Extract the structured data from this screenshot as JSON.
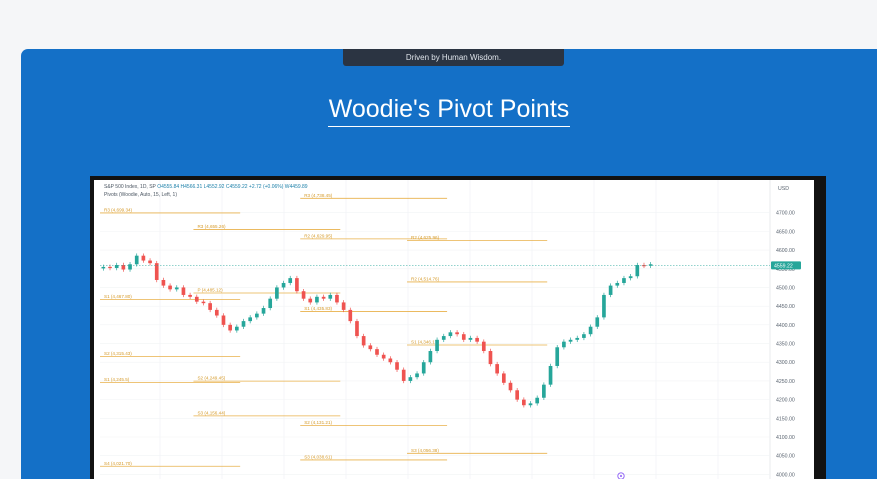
{
  "tagline": "Driven by Human Wisdom.",
  "headline": "Woodie's Pivot Points",
  "legend": {
    "symbol": "S&P 500 Index, 1D, SP",
    "values": "O4555.84  H4566.31  L4552.92  C4559.22  +2.72 (+0.06%)  W4459.89",
    "indicator": "Pivots (Woodie, Auto, 15, Left, 1)"
  },
  "colors": {
    "panel": "#1470c7",
    "up_candle": "#26a69a",
    "down_candle": "#ef5350",
    "pivot_line": "#e8b04a",
    "pivot_label": "#d59a2a",
    "last_price": "#26a69a"
  },
  "chart_data": {
    "type": "candlestick",
    "price_axis": {
      "currency": "USD",
      "ticks": [
        "4700.00",
        "4650.00",
        "4600.00",
        "4550.00",
        "4500.00",
        "4450.00",
        "4400.00",
        "4350.00",
        "4300.00",
        "4250.00",
        "4200.00",
        "4150.00",
        "4100.00",
        "4050.00",
        "4000.00"
      ],
      "ylim": [
        3985,
        4750
      ],
      "last_price_label": "4559.22"
    },
    "closes": [
      4555,
      4552,
      4560,
      4548,
      4562,
      4585,
      4572,
      4565,
      4520,
      4505,
      4495,
      4500,
      4480,
      4475,
      4462,
      4458,
      4440,
      4425,
      4400,
      4385,
      4395,
      4410,
      4420,
      4430,
      4445,
      4470,
      4500,
      4512,
      4525,
      4490,
      4470,
      4460,
      4475,
      4470,
      4480,
      4460,
      4440,
      4410,
      4370,
      4345,
      4335,
      4320,
      4310,
      4300,
      4280,
      4250,
      4260,
      4270,
      4300,
      4330,
      4360,
      4370,
      4380,
      4375,
      4360,
      4365,
      4355,
      4330,
      4295,
      4270,
      4245,
      4225,
      4200,
      4185,
      4190,
      4205,
      4240,
      4290,
      4340,
      4355,
      4360,
      4365,
      4375,
      4395,
      4420,
      4480,
      4505,
      4512,
      4525,
      4530,
      4560,
      4558,
      4562
    ],
    "pivot_levels": [
      {
        "label": "R3 (4,738.45)",
        "price": 4738.45,
        "from": 30,
        "to": 52
      },
      {
        "label": "R3 (4,699.34)",
        "price": 4699.34,
        "from": 0,
        "to": 21
      },
      {
        "label": "R3 (4,655.26)",
        "price": 4655.26,
        "from": 14,
        "to": 36
      },
      {
        "label": "R2 (4,629.95)",
        "price": 4629.95,
        "from": 30,
        "to": 52
      },
      {
        "label": "R2 (4,625.96)",
        "price": 4625.96,
        "from": 46,
        "to": 67
      },
      {
        "label": "R2 (4,514.76)",
        "price": 4514.76,
        "from": 46,
        "to": 67
      },
      {
        "label": "P (4,485.12)",
        "price": 4485.12,
        "from": 14,
        "to": 36
      },
      {
        "label": "S1 (4,467.80)",
        "price": 4467.8,
        "from": 0,
        "to": 21
      },
      {
        "label": "S1 (4,435.83)",
        "price": 4435.83,
        "from": 30,
        "to": 52
      },
      {
        "label": "S1 (4,346.17)",
        "price": 4346.17,
        "from": 46,
        "to": 67
      },
      {
        "label": "S2 (4,315.43)",
        "price": 4315.43,
        "from": 0,
        "to": 21
      },
      {
        "label": "S1 (4,245.5)",
        "price": 4245.5,
        "from": 0,
        "to": 21
      },
      {
        "label": "S2 (4,249.45)",
        "price": 4249.45,
        "from": 14,
        "to": 36
      },
      {
        "label": "S3 (4,156.44)",
        "price": 4156.44,
        "from": 14,
        "to": 36
      },
      {
        "label": "S2 (4,131.21)",
        "price": 4131.21,
        "from": 30,
        "to": 52
      },
      {
        "label": "S3 (4,056.38)",
        "price": 4056.38,
        "from": 46,
        "to": 67
      },
      {
        "label": "S3 (4,038.61)",
        "price": 4038.61,
        "from": 30,
        "to": 52
      },
      {
        "label": "S4 (4,021.70)",
        "price": 4021.7,
        "from": 0,
        "to": 21
      }
    ]
  }
}
